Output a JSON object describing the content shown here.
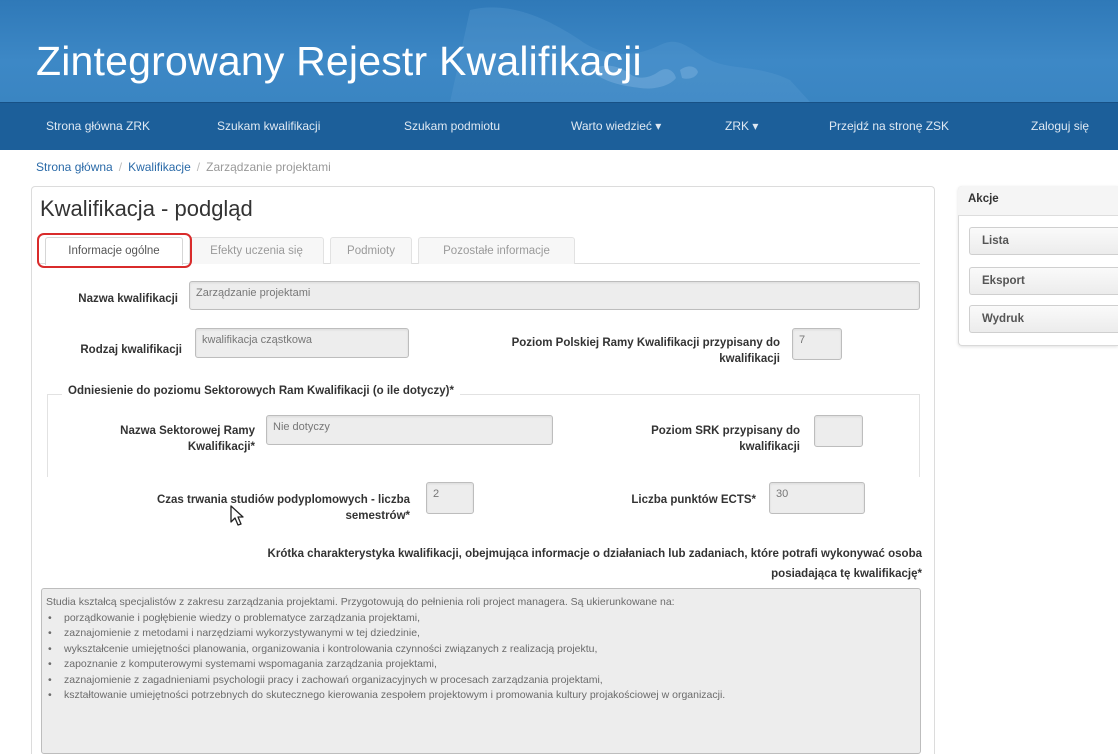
{
  "header": {
    "title": "Zintegrowany Rejestr Kwalifikacji"
  },
  "nav": {
    "items": [
      "Strona główna ZRK",
      "Szukam kwalifikacji",
      "Szukam podmiotu",
      "Warto wiedzieć ▾",
      "ZRK ▾",
      "Przejdź na stronę ZSK",
      "Zaloguj się"
    ]
  },
  "breadcrumb": {
    "home": "Strona główna",
    "section": "Kwalifikacje",
    "current": "Zarządzanie projektami"
  },
  "page": {
    "title": "Kwalifikacja - podgląd"
  },
  "tabs": [
    "Informacje ogólne",
    "Efekty uczenia się",
    "Podmioty",
    "Pozostałe informacje"
  ],
  "form": {
    "name_label": "Nazwa kwalifikacji",
    "name_value": "Zarządzanie projektami",
    "type_label": "Rodzaj kwalifikacji",
    "type_value": "kwalifikacja cząstkowa",
    "prk_label_1": "Poziom Polskiej Ramy Kwalifikacji przypisany do",
    "prk_label_2": "kwalifikacji",
    "prk_value": "7",
    "src_legend": "Odniesienie do poziomu Sektorowych Ram Kwalifikacji (o ile dotyczy)*",
    "src_name_label_1": "Nazwa Sektorowej Ramy",
    "src_name_label_2": "Kwalifikacji*",
    "src_name_value": "Nie dotyczy",
    "src_level_label_1": "Poziom SRK przypisany do",
    "src_level_label_2": "kwalifikacji",
    "src_level_value": "",
    "duration_label_1": "Czas trwania studiów podyplomowych - liczba",
    "duration_label_2": "semestrów*",
    "duration_value": "2",
    "ects_label": "Liczba punktów ECTS*",
    "ects_value": "30",
    "desc_label_1": "Krótka charakterystyka kwalifikacji, obejmująca informacje o działaniach lub zadaniach, które potrafi wykonywać osoba",
    "desc_label_2": "posiadająca tę kwalifikację*",
    "desc_intro": "Studia kształcą specjalistów z zakresu zarządzania projektami. Przygotowują do pełnienia roli project managera. Są ukierunkowane na:",
    "desc_items": [
      "porządkowanie i pogłębienie wiedzy o problematyce zarządzania projektami,",
      "zaznajomienie z metodami i narzędziami wykorzystywanymi w tej dziedzinie,",
      "wykształcenie umiejętności planowania, organizowania i kontrolowania czynności związanych z realizacją projektu,",
      "zapoznanie z komputerowymi systemami wspomagania zarządzania projektami,",
      "zaznajomienie z zagadnieniami psychologii pracy i zachowań organizacyjnych w procesach zarządzania projektami,",
      "kształtowanie umiejętności potrzebnych do skutecznego kierowania zespołem projektowym i promowania kultury projakościowej w organizacji."
    ]
  },
  "actions": {
    "header": "Akcje",
    "buttons": [
      "Lista",
      "Eksport",
      "Wydruk"
    ]
  },
  "colors": {
    "banner": "#3d88c6",
    "navbar": "#1c5f9a",
    "highlight": "#d92b2b",
    "link": "#2a6aa8"
  }
}
